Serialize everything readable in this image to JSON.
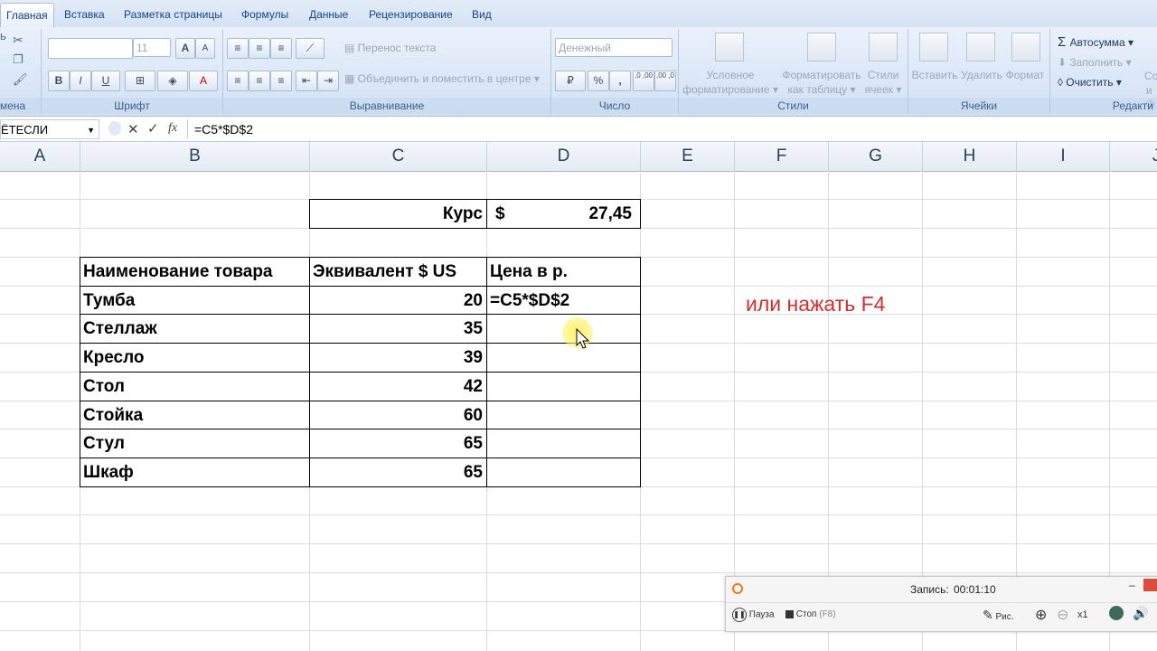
{
  "tabs": [
    "Главная",
    "Вставка",
    "Разметка страницы",
    "Формулы",
    "Данные",
    "Рецензирование",
    "Вид"
  ],
  "ribbon": {
    "clipboard_label": "мена",
    "font": {
      "name": "",
      "size": "11",
      "label": "Шрифт",
      "bold": "B",
      "italic": "I",
      "underline": "U",
      "grow": "A",
      "shrink": "A",
      "color": "A"
    },
    "alignment": {
      "wrap": "Перенос текста",
      "merge": "Объединить и поместить в центре",
      "label": "Выравнивание"
    },
    "number": {
      "format": "Денежный",
      "percent": "%",
      "comma": ",",
      "inc": ",0 ,00",
      "dec": ",00 ,0",
      "label": "Число"
    },
    "styles": {
      "cond_l1": "Условное",
      "cond_l2": "форматирование",
      "table_l1": "Форматировать",
      "table_l2": "как таблицу",
      "cell_l1": "Стили",
      "cell_l2": "ячеек",
      "label": "Стили"
    },
    "cells": {
      "insert": "Вставить",
      "delete": "Удалить",
      "format": "Формат",
      "label": "Ячейки"
    },
    "editing": {
      "autosum": "Автосумма",
      "fill": "Заполнить",
      "clear": "Очистить",
      "label": "Редакти",
      "partial1": "Со",
      "partial2": "и ф"
    }
  },
  "formula_bar": {
    "name_box": "ЁТЕСЛИ",
    "formula": "=C5*$D$2",
    "fx": "fx"
  },
  "columns": [
    "A",
    "B",
    "C",
    "D",
    "E",
    "F",
    "G",
    "H",
    "I",
    "J"
  ],
  "sheet": {
    "rate_label": "Курс",
    "rate_currency": "$",
    "rate_value": "27,45",
    "headers": [
      "Наименование товара",
      "Эквивалент $ US",
      "Цена в р."
    ],
    "rows": [
      {
        "name": "Тумба",
        "usd": "20",
        "price": "=C5*$D$2"
      },
      {
        "name": "Стеллаж",
        "usd": "35",
        "price": ""
      },
      {
        "name": "Кресло",
        "usd": "39",
        "price": ""
      },
      {
        "name": "Стол",
        "usd": "42",
        "price": ""
      },
      {
        "name": "Стойка",
        "usd": "60",
        "price": ""
      },
      {
        "name": "Стул",
        "usd": "65",
        "price": ""
      },
      {
        "name": "Шкаф",
        "usd": "65",
        "price": ""
      }
    ],
    "annotation": "или нажать F4",
    "annotation_color": "#d92b2b"
  },
  "recorder": {
    "status_label": "Запись:",
    "time": "00:01:10",
    "pause": "Пауза",
    "stop": "Стоп",
    "stop_key": "(F8)",
    "draw": "Рис.",
    "zoom": "x1"
  }
}
